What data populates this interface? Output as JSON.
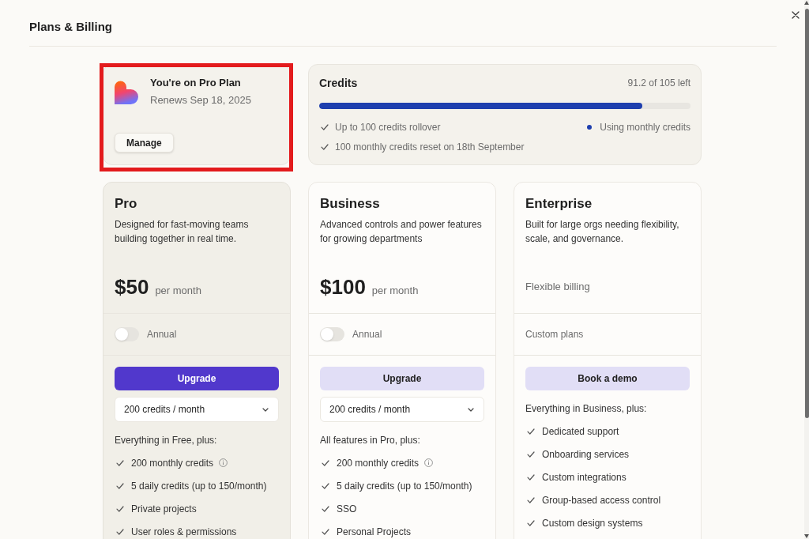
{
  "header": {
    "title": "Plans & Billing"
  },
  "current_plan": {
    "highlighted": true,
    "title": "You're on Pro Plan",
    "renewal": "Renews Sep 18, 2025",
    "button": "Manage"
  },
  "credits": {
    "title": "Credits",
    "remaining": "91.2 of 105 left",
    "level": 0.87,
    "notes": [
      {
        "text": "Up to 100 credits rollover"
      },
      {
        "text": "100 monthly credits reset on 18th September"
      }
    ],
    "status": {
      "label": "Using monthly credits"
    }
  },
  "plans": [
    {
      "name": "Pro",
      "current": true,
      "description": "Designed for fast-moving teams building together in real time.",
      "price": "$50",
      "period": "per month",
      "billing_toggle": {
        "label": "Annual",
        "on": false
      },
      "button": {
        "label": "Upgrade",
        "kind": "primary"
      },
      "credits_select": {
        "value": "200 credits / month"
      },
      "features_heading": "Everything in Free, plus:",
      "features": [
        {
          "text": "200 monthly credits",
          "info": true
        },
        {
          "text": "5 daily credits (up to 150/month)",
          "info": false
        },
        {
          "text": "Private projects",
          "info": false
        },
        {
          "text": "User roles & permissions",
          "info": false
        }
      ]
    },
    {
      "name": "Business",
      "current": false,
      "description": "Advanced controls and power features for growing departments",
      "price": "$100",
      "period": "per month",
      "billing_toggle": {
        "label": "Annual",
        "on": false
      },
      "button": {
        "label": "Upgrade",
        "kind": "secondary"
      },
      "credits_select": {
        "value": "200 credits / month"
      },
      "features_heading": "All features in Pro, plus:",
      "features": [
        {
          "text": "200 monthly credits",
          "info": true
        },
        {
          "text": "5 daily credits (up to 150/month)",
          "info": false
        },
        {
          "text": "SSO",
          "info": false
        },
        {
          "text": "Personal Projects",
          "info": false
        }
      ]
    },
    {
      "name": "Enterprise",
      "current": false,
      "description": "Built for large orgs needing flexibility, scale, and governance.",
      "price_note": "Flexible billing",
      "plans_note": "Custom plans",
      "button": {
        "label": "Book a demo",
        "kind": "secondary"
      },
      "features_heading": "Everything in Business, plus:",
      "features": [
        {
          "text": "Dedicated support",
          "info": false
        },
        {
          "text": "Onboarding services",
          "info": false
        },
        {
          "text": "Custom integrations",
          "info": false
        },
        {
          "text": "Group-based access control",
          "info": false
        },
        {
          "text": "Custom design systems",
          "info": false
        }
      ]
    }
  ]
}
